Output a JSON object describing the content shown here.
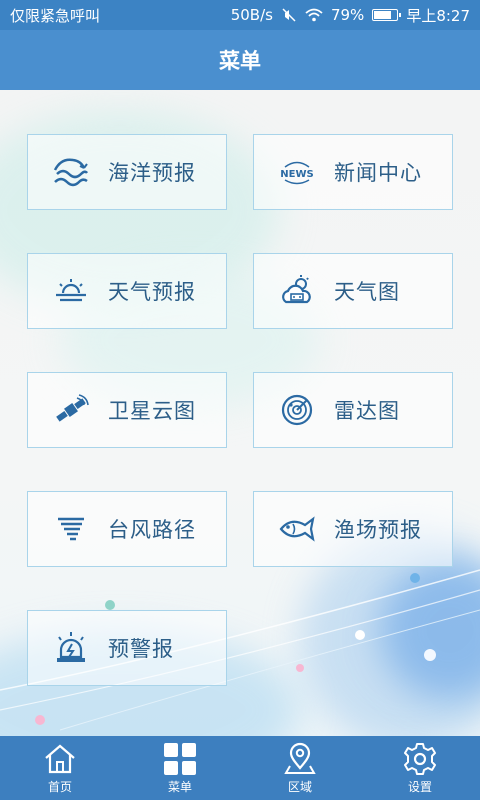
{
  "status_bar": {
    "carrier": "仅限紧急呼叫",
    "speed": "50B/s",
    "battery_percent": "79%",
    "battery_level": 0.79,
    "time": "早上8:27"
  },
  "title": "菜单",
  "menu": [
    {
      "label": "海洋预报",
      "icon": "ocean-wave-icon"
    },
    {
      "label": "新闻中心",
      "icon": "news-icon",
      "icon_text": "NEWS"
    },
    {
      "label": "天气预报",
      "icon": "sun-cloud-icon"
    },
    {
      "label": "天气图",
      "icon": "weather-map-icon"
    },
    {
      "label": "卫星云图",
      "icon": "satellite-icon"
    },
    {
      "label": "雷达图",
      "icon": "radar-icon"
    },
    {
      "label": "台风路径",
      "icon": "typhoon-icon"
    },
    {
      "label": "渔场预报",
      "icon": "fish-icon"
    },
    {
      "label": "预警报",
      "icon": "warning-light-icon"
    }
  ],
  "bottom_nav": [
    {
      "label": "首页",
      "icon": "home-icon"
    },
    {
      "label": "菜单",
      "icon": "grid-menu-icon"
    },
    {
      "label": "区域",
      "icon": "location-pin-icon"
    },
    {
      "label": "设置",
      "icon": "gear-icon"
    }
  ],
  "colors": {
    "status_bar": "#3c83c4",
    "title_bar": "#4a8fcf",
    "bottom_nav": "#3d7fbf",
    "icon": "#2b6aa3",
    "label": "#2c5e88",
    "button_border": "#a9d4ea"
  }
}
